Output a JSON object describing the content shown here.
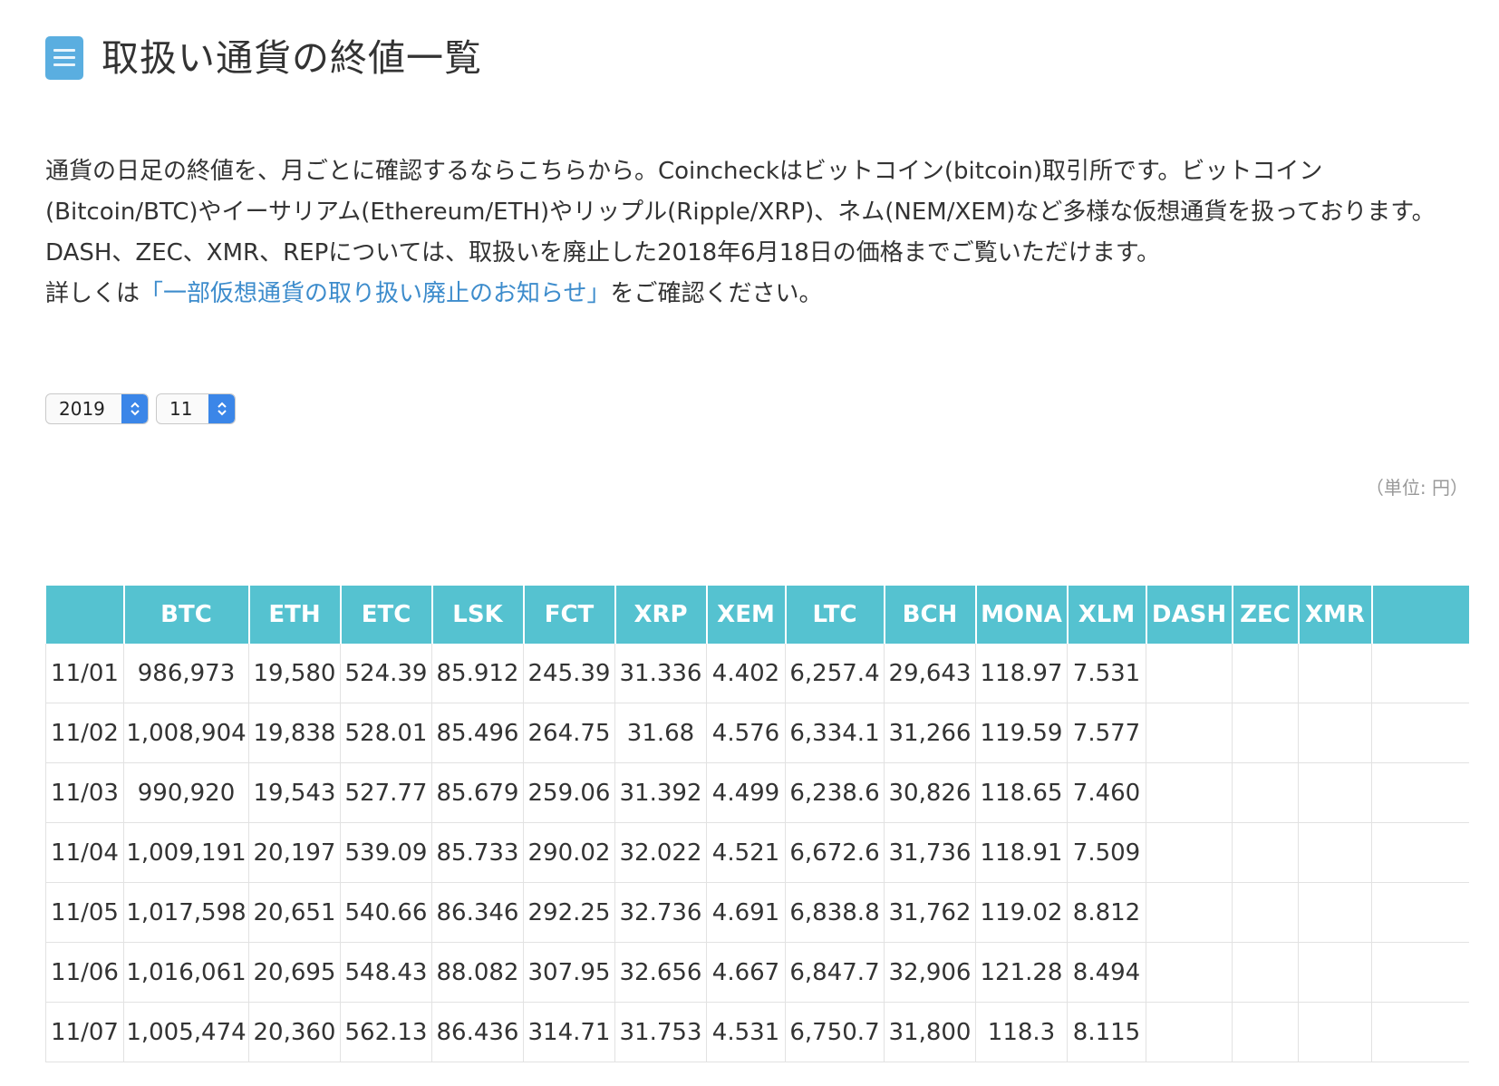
{
  "header": {
    "title": "取扱い通貨の終値一覧",
    "icon": "document-list-icon"
  },
  "intro": {
    "line1": "通貨の日足の終値を、月ごとに確認するならこちらから。Coincheckはビットコイン(bitcoin)取引所です。ビットコイン(Bitcoin/BTC)やイーサリアム(Ethereum/ETH)やリップル(Ripple/XRP)、ネム(NEM/XEM)など多様な仮想通貨を扱っております。",
    "line2": "DASH、ZEC、XMR、REPについては、取扱いを廃止した2018年6月18日の価格までご覧いただけます。",
    "line3_prefix": "詳しくは",
    "line3_link": "「一部仮想通貨の取り扱い廃止のお知らせ」",
    "line3_suffix": "をご確認ください。"
  },
  "selectors": {
    "year": "2019",
    "month": "11"
  },
  "unit_label": "（単位: 円）",
  "colors": {
    "header_bg": "#55c2d0",
    "link": "#3d8ccc",
    "select_arrow": "#3b86e8",
    "icon": "#5aaee0"
  },
  "table": {
    "columns": [
      "",
      "BTC",
      "ETH",
      "ETC",
      "LSK",
      "FCT",
      "XRP",
      "XEM",
      "LTC",
      "BCH",
      "MONA",
      "XLM",
      "DASH",
      "ZEC",
      "XMR",
      ""
    ],
    "rows": [
      [
        "11/01",
        "986,973",
        "19,580",
        "524.39",
        "85.912",
        "245.39",
        "31.336",
        "4.402",
        "6,257.4",
        "29,643",
        "118.97",
        "7.531",
        "",
        "",
        "",
        ""
      ],
      [
        "11/02",
        "1,008,904",
        "19,838",
        "528.01",
        "85.496",
        "264.75",
        "31.68",
        "4.576",
        "6,334.1",
        "31,266",
        "119.59",
        "7.577",
        "",
        "",
        "",
        ""
      ],
      [
        "11/03",
        "990,920",
        "19,543",
        "527.77",
        "85.679",
        "259.06",
        "31.392",
        "4.499",
        "6,238.6",
        "30,826",
        "118.65",
        "7.460",
        "",
        "",
        "",
        ""
      ],
      [
        "11/04",
        "1,009,191",
        "20,197",
        "539.09",
        "85.733",
        "290.02",
        "32.022",
        "4.521",
        "6,672.6",
        "31,736",
        "118.91",
        "7.509",
        "",
        "",
        "",
        ""
      ],
      [
        "11/05",
        "1,017,598",
        "20,651",
        "540.66",
        "86.346",
        "292.25",
        "32.736",
        "4.691",
        "6,838.8",
        "31,762",
        "119.02",
        "8.812",
        "",
        "",
        "",
        ""
      ],
      [
        "11/06",
        "1,016,061",
        "20,695",
        "548.43",
        "88.082",
        "307.95",
        "32.656",
        "4.667",
        "6,847.7",
        "32,906",
        "121.28",
        "8.494",
        "",
        "",
        "",
        ""
      ],
      [
        "11/07",
        "1,005,474",
        "20,360",
        "562.13",
        "86.436",
        "314.71",
        "31.753",
        "4.531",
        "6,750.7",
        "31,800",
        "118.3",
        "8.115",
        "",
        "",
        "",
        ""
      ]
    ]
  }
}
